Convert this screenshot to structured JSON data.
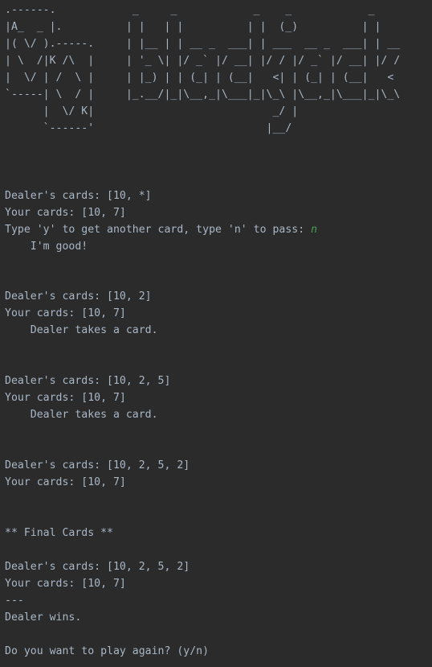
{
  "console": {
    "lines": [
      {
        "text": ".------.            _     _            _    _            _"
      },
      {
        "text": "|A_  _ |.          | |   | |          | |  (_)          | |"
      },
      {
        "text": "|( \\/ ).-----.     | |__ | | __ _  ___| | ___  __ _  ___| | __"
      },
      {
        "text": "| \\  /|K /\\  |     | '_ \\| |/ _` |/ __| |/ / |/ _` |/ __| |/ /"
      },
      {
        "text": "|  \\/ | /  \\ |     | |_) | | (_| | (__|   <| | (_| | (__|   <"
      },
      {
        "text": "`-----| \\  / |     |_.__/|_|\\__,_|\\___|_|\\_\\ |\\__,_|\\___|_|\\_\\"
      },
      {
        "text": "      |  \\/ K|                            _/ |"
      },
      {
        "text": "      `------'                           |__/"
      },
      {
        "text": ""
      },
      {
        "text": ""
      },
      {
        "text": ""
      },
      {
        "text": "Dealer's cards: [10, *]"
      },
      {
        "text": "Your cards: [10, 7]"
      },
      {
        "text": "Type 'y' to get another card, type 'n' to pass: ",
        "input": "n"
      },
      {
        "text": "    I'm good!"
      },
      {
        "text": ""
      },
      {
        "text": ""
      },
      {
        "text": "Dealer's cards: [10, 2]"
      },
      {
        "text": "Your cards: [10, 7]"
      },
      {
        "text": "    Dealer takes a card."
      },
      {
        "text": ""
      },
      {
        "text": ""
      },
      {
        "text": "Dealer's cards: [10, 2, 5]"
      },
      {
        "text": "Your cards: [10, 7]"
      },
      {
        "text": "    Dealer takes a card."
      },
      {
        "text": ""
      },
      {
        "text": ""
      },
      {
        "text": "Dealer's cards: [10, 2, 5, 2]"
      },
      {
        "text": "Your cards: [10, 7]"
      },
      {
        "text": ""
      },
      {
        "text": ""
      },
      {
        "text": "** Final Cards **"
      },
      {
        "text": ""
      },
      {
        "text": "Dealer's cards: [10, 2, 5, 2]"
      },
      {
        "text": "Your cards: [10, 7]"
      },
      {
        "text": "---"
      },
      {
        "text": "Dealer wins."
      },
      {
        "text": ""
      },
      {
        "text": "Do you want to play again? (y/n)"
      }
    ]
  },
  "colors": {
    "background": "#2b2b2b",
    "text": "#a9b7c6",
    "input": "#499c54"
  }
}
